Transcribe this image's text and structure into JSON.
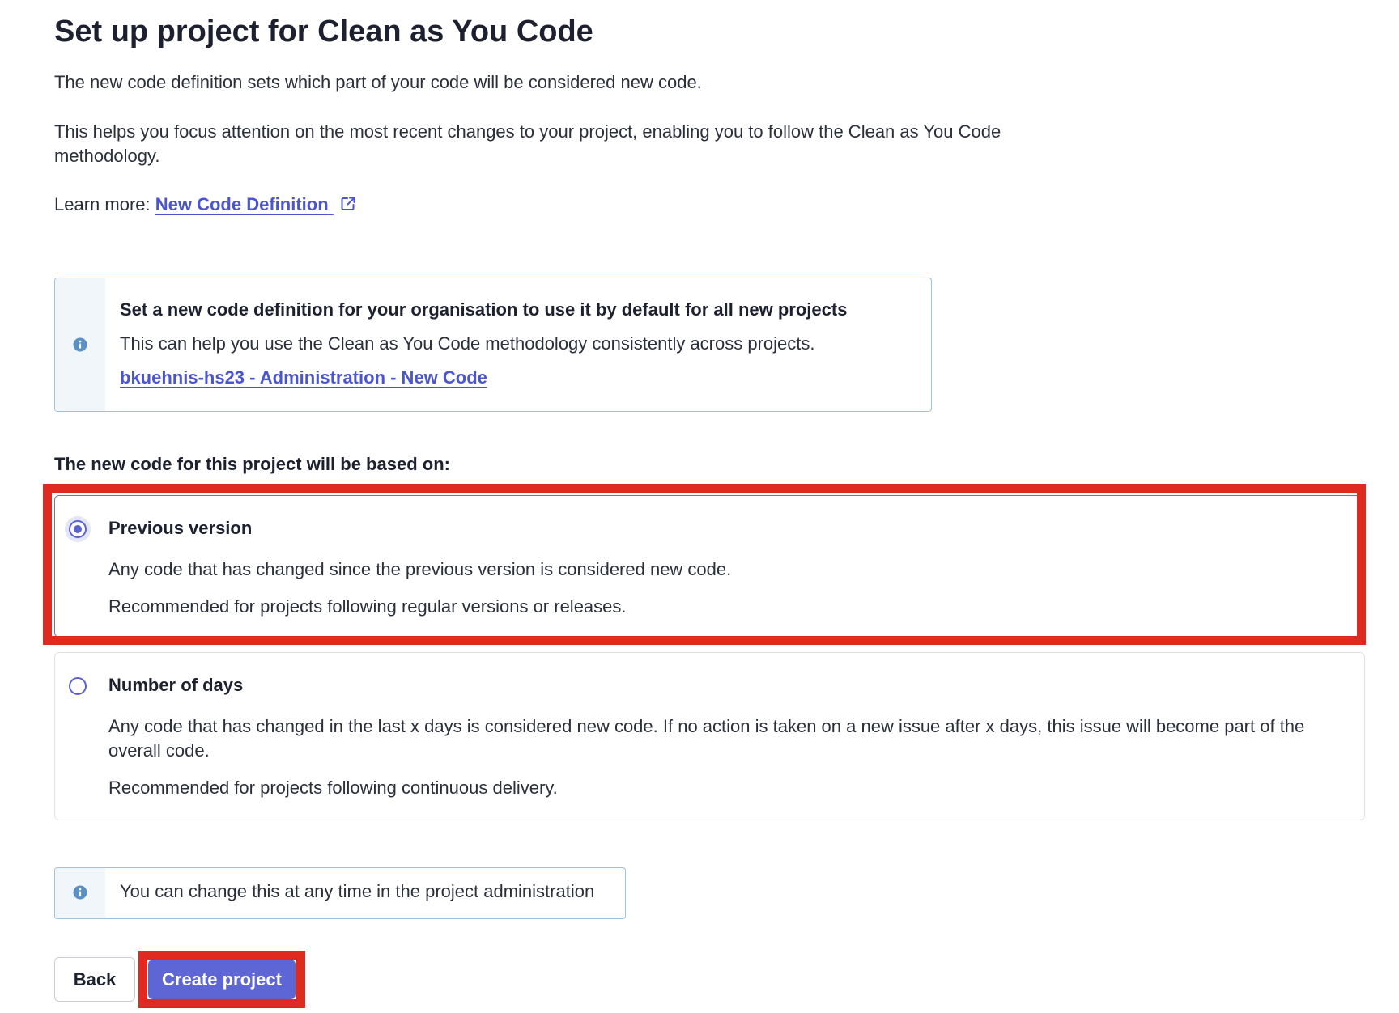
{
  "page": {
    "title": "Set up project for Clean as You Code",
    "intro": "The new code definition sets which part of your code will be considered new code.",
    "intro2": "This helps you focus attention on the most recent changes to your project, enabling you to follow the Clean as You Code methodology.",
    "learn_more_prefix": "Learn more:",
    "learn_more_link": "New Code Definition"
  },
  "org_notice": {
    "title": "Set a new code definition for your organisation to use it by default for all new projects",
    "description": "This can help you use the Clean as You Code methodology consistently across projects.",
    "link": "bkuehnis-hs23 - Administration - New Code"
  },
  "based_on_label": "The new code for this project will be based on:",
  "options": [
    {
      "title": "Previous version",
      "description": "Any code that has changed since the previous version is considered new code.",
      "recommendation": "Recommended for projects following regular versions or releases.",
      "selected": true
    },
    {
      "title": "Number of days",
      "description": "Any code that has changed in the last x days is considered new code. If no action is taken on a new issue after x days, this issue will become part of the overall code.",
      "recommendation": "Recommended for projects following continuous delivery.",
      "selected": false
    }
  ],
  "change_notice": "You can change this at any time in the project administration",
  "buttons": {
    "back": "Back",
    "create": "Create project"
  },
  "colors": {
    "accent": "#5d66d4",
    "link": "#4c55d1",
    "highlight": "#e0291f",
    "info_border": "#9bc4e4"
  },
  "icons": {
    "external_link": "external-link-icon",
    "info": "info-icon"
  }
}
